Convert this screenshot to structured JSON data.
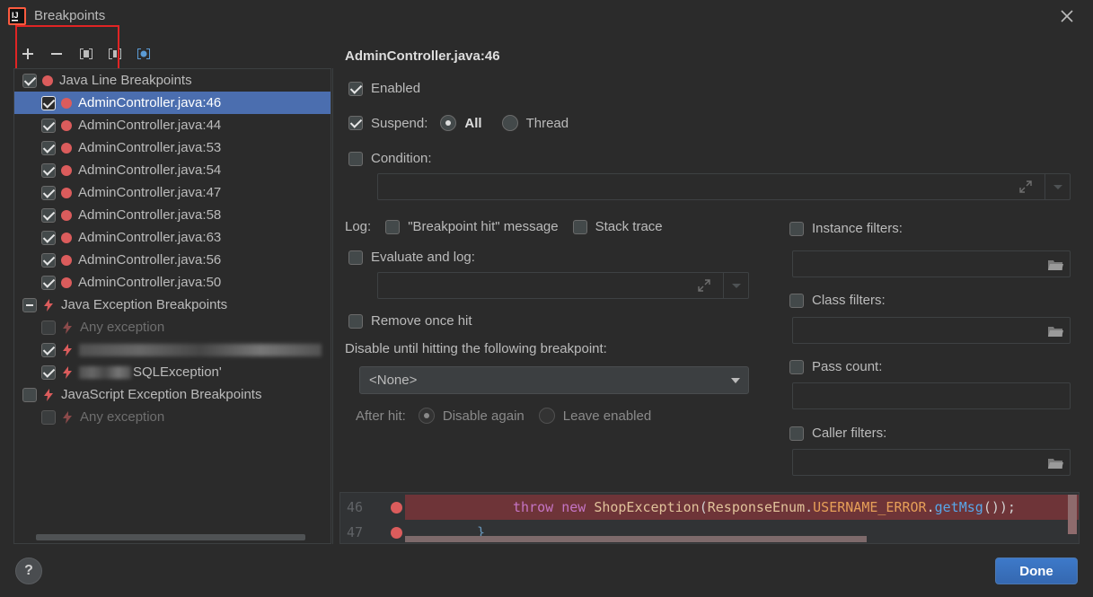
{
  "window": {
    "title": "Breakpoints"
  },
  "toolbar": {
    "add": "+",
    "remove": "−"
  },
  "tree": {
    "groups": [
      {
        "label": "Java Line Breakpoints"
      },
      {
        "label": "Java Exception Breakpoints"
      },
      {
        "label": "JavaScript Exception Breakpoints"
      }
    ],
    "line_items": [
      "AdminController.java:46",
      "AdminController.java:44",
      "AdminController.java:53",
      "AdminController.java:54",
      "AdminController.java:47",
      "AdminController.java:58",
      "AdminController.java:63",
      "AdminController.java:56",
      "AdminController.java:50"
    ],
    "exception_items": [
      "Any exception",
      "",
      "SQLException'"
    ],
    "js_items": [
      "Any exception"
    ]
  },
  "props": {
    "title": "AdminController.java:46",
    "enabled": "Enabled",
    "suspend": "Suspend:",
    "all": "All",
    "thread": "Thread",
    "condition": "Condition:",
    "log": "Log:",
    "bp_hit_message": "\"Breakpoint hit\" message",
    "stack_trace": "Stack trace",
    "evaluate_log": "Evaluate and log:",
    "remove_once_hit": "Remove once hit",
    "disable_until": "Disable until hitting the following breakpoint:",
    "none_option": "<None>",
    "after_hit": "After hit:",
    "disable_again": "Disable again",
    "leave_enabled": "Leave enabled",
    "instance_filters": "Instance filters:",
    "class_filters": "Class filters:",
    "pass_count": "Pass count:",
    "caller_filters": "Caller filters:"
  },
  "code": {
    "line1_num": "46",
    "line2_num": "47",
    "l1_throw": "throw",
    "l1_new": "new",
    "l1_class": "ShopException",
    "l1_p1": "(",
    "l1_enum": "ResponseEnum",
    "l1_dot": ".",
    "l1_const": "USERNAME_ERROR",
    "l1_dot2": ".",
    "l1_method": "getMsg",
    "l1_end": "());",
    "l2_text": "}"
  },
  "footer": {
    "help": "?",
    "done": "Done"
  },
  "colors": {
    "accent": "#4b6eaf",
    "breakpoint": "#db5c5c",
    "done_bg": "#3568b0"
  }
}
